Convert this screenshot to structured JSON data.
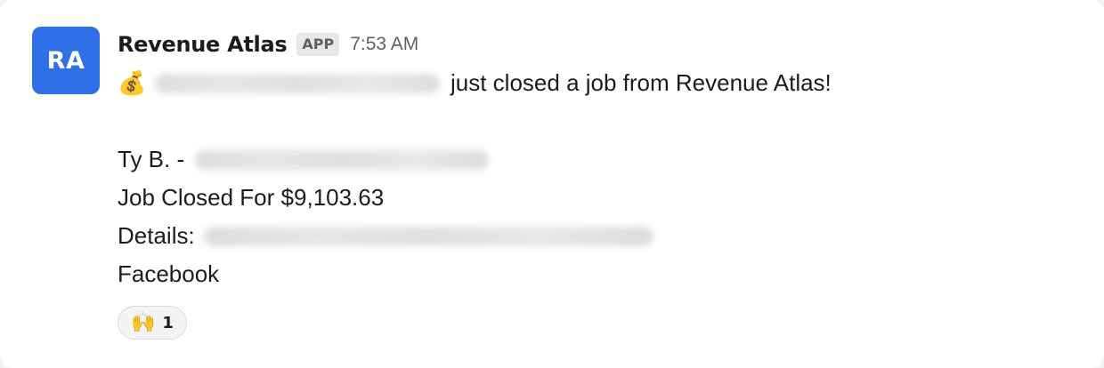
{
  "message": {
    "avatar_initials": "RA",
    "sender": "Revenue Atlas",
    "badge": "APP",
    "time": "7:53 AM",
    "lines": {
      "intro_emoji": "💰",
      "intro_text": "just closed a job from Revenue Atlas!",
      "rep": "Ty B. -",
      "amount": "Job Closed For $9,103.63",
      "details_label": "Details:",
      "source": "Facebook"
    }
  },
  "reactions": [
    {
      "emoji": "🙌",
      "icon": "raised-hands-icon",
      "count": "1"
    }
  ],
  "colors": {
    "avatar_bg": "#2f6fe8",
    "text": "#1d1c1d",
    "muted": "#616061",
    "badge_bg": "#e8e8e8"
  }
}
